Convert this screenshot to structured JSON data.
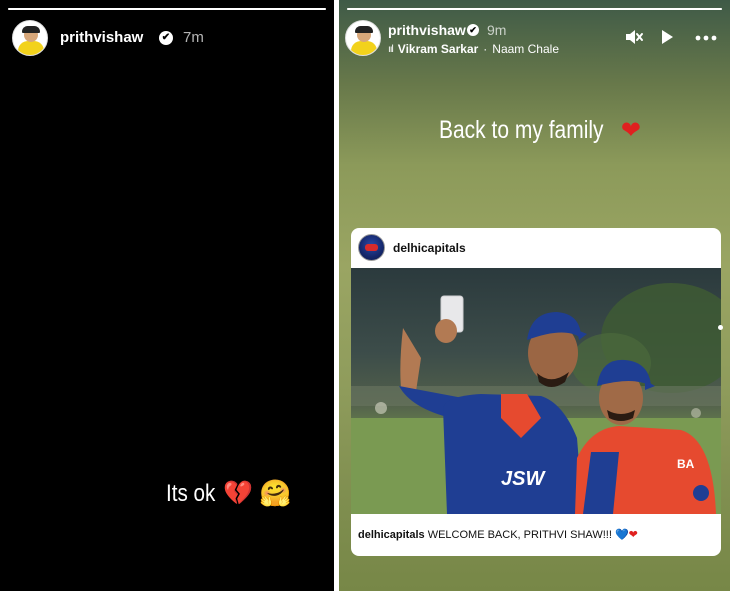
{
  "left_story": {
    "username": "prithvishaw",
    "verified_glyph": "✔",
    "time": "7m",
    "progress": 1.0,
    "caption": "Its ok",
    "emoji_broken_heart": "💔",
    "emoji_hug": "🤗"
  },
  "right_story": {
    "username": "prithvishaw",
    "verified_glyph": "✔",
    "time": "9m",
    "progress": 1.0,
    "music": {
      "bars_icon": "ııl",
      "artist": "Vikram Sarkar",
      "separator": "·",
      "song": "Naam Chale"
    },
    "controls": {
      "mute_icon": "🔇",
      "play_icon": "▶",
      "more_icon": "•••"
    },
    "caption": "Back to my family",
    "caption_emoji": "❤",
    "shared_post": {
      "username": "delhicapitals",
      "caption_user": "delhicapitals",
      "caption_text": "WELCOME BACK, PRITHVI SHAW!!!",
      "caption_emoji_blue": "💙",
      "caption_emoji_red": "❤",
      "jersey_sponsor": "JSW"
    }
  },
  "colors": {
    "left_background": "#000000",
    "right_background_top": "#3f5a47",
    "right_background_mid": "#9aa563",
    "jersey_blue": "#1f3e93",
    "jersey_red": "#e64a2f"
  }
}
